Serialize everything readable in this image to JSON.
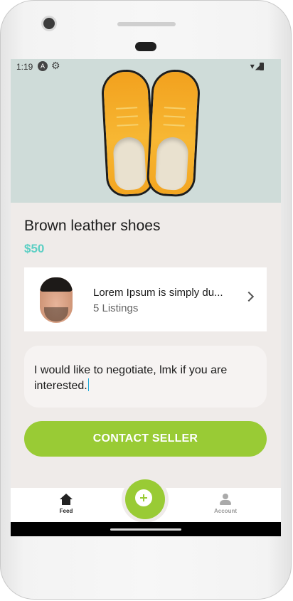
{
  "status_bar": {
    "time": "1:19",
    "icons": [
      "a-badge-icon",
      "gear-icon",
      "wifi-icon",
      "signal-icon",
      "battery-icon"
    ]
  },
  "product": {
    "title": "Brown leather shoes",
    "price": "$50",
    "image": "orange-leather-shoes"
  },
  "seller": {
    "name": "Lorem Ipsum is simply du...",
    "listings": "5 Listings"
  },
  "message": {
    "text": "I would like to negotiate, lmk if you are interested."
  },
  "actions": {
    "contact_label": "CONTACT SELLER"
  },
  "bottom_nav": {
    "feed_label": "Feed",
    "account_label": "Account"
  },
  "colors": {
    "accent_green": "#99cb35",
    "price_teal": "#5ccfc4",
    "background": "#efebe9"
  }
}
